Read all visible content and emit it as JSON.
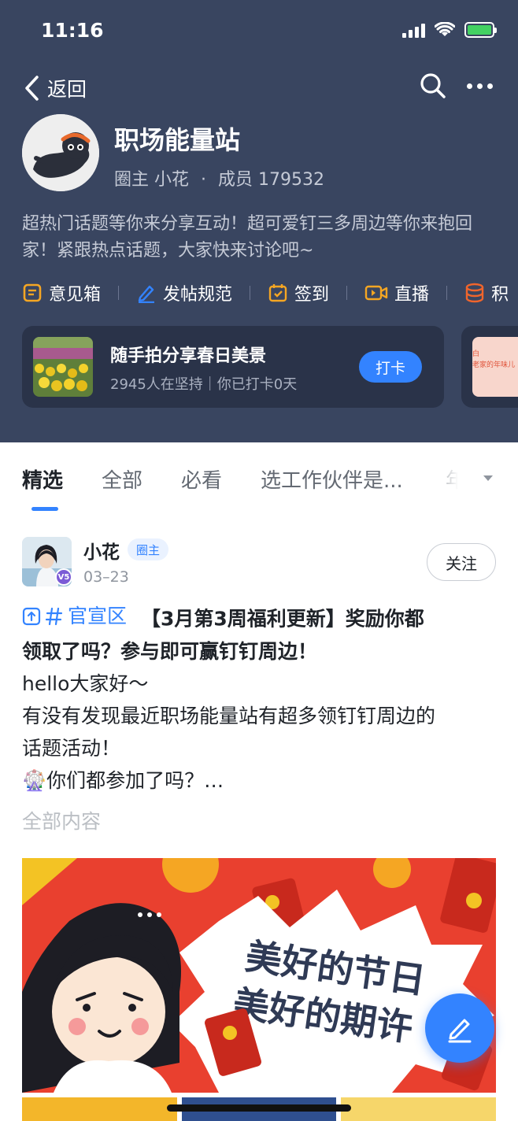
{
  "status_bar": {
    "time": "11:16"
  },
  "nav": {
    "back_label": "返回"
  },
  "group": {
    "name": "职场能量站",
    "owner_label": "圈主 小花",
    "separator": "·",
    "members_label": "成员 179532",
    "description": "超热门话题等你来分享互动！超可爱钉三多周边等你来抱回家！紧跟热点话题，大家快来讨论吧~"
  },
  "toolbar": [
    {
      "label": "意见箱",
      "icon": "inbox-icon"
    },
    {
      "label": "发帖规范",
      "icon": "pen-icon"
    },
    {
      "label": "签到",
      "icon": "calendar-check-icon"
    },
    {
      "label": "直播",
      "icon": "video-icon"
    },
    {
      "label": "积",
      "icon": "database-icon"
    }
  ],
  "checkin_card": {
    "title": "随手拍分享春日美景",
    "subtitle": "2945人在坚持｜你已打卡0天",
    "button": "打卡"
  },
  "next_card": {
    "line1": "白",
    "line2": "老家的年味儿"
  },
  "tabs": [
    {
      "label": "精选",
      "active": true
    },
    {
      "label": "全部",
      "active": false
    },
    {
      "label": "必看",
      "active": false
    },
    {
      "label": "选工作伙伴是...",
      "active": false
    },
    {
      "label": "年",
      "active": false
    }
  ],
  "post": {
    "author": "小花",
    "role_tag": "圈主",
    "vip_badge": "V5",
    "date": "03–23",
    "follow_label": "关注",
    "topic": "官宣区",
    "title_line1": "【3月第3周福利更新】奖励你都",
    "title_line2": "领取了吗？参与即可赢钉钉周边！",
    "body_lines": [
      "hello大家好～",
      "有没有发现最近职场能量站有超多领钉钉周边的",
      "话题活动！",
      "🎡你们都参加了吗？…"
    ],
    "read_more": "全部内容",
    "banner_line1": "美好的节日",
    "banner_line2": "美好的期许"
  },
  "colors": {
    "header_bg": "#394560",
    "accent": "#3383ff",
    "toolbar_icon": "#f5a623",
    "banner_red": "#e9402f"
  }
}
